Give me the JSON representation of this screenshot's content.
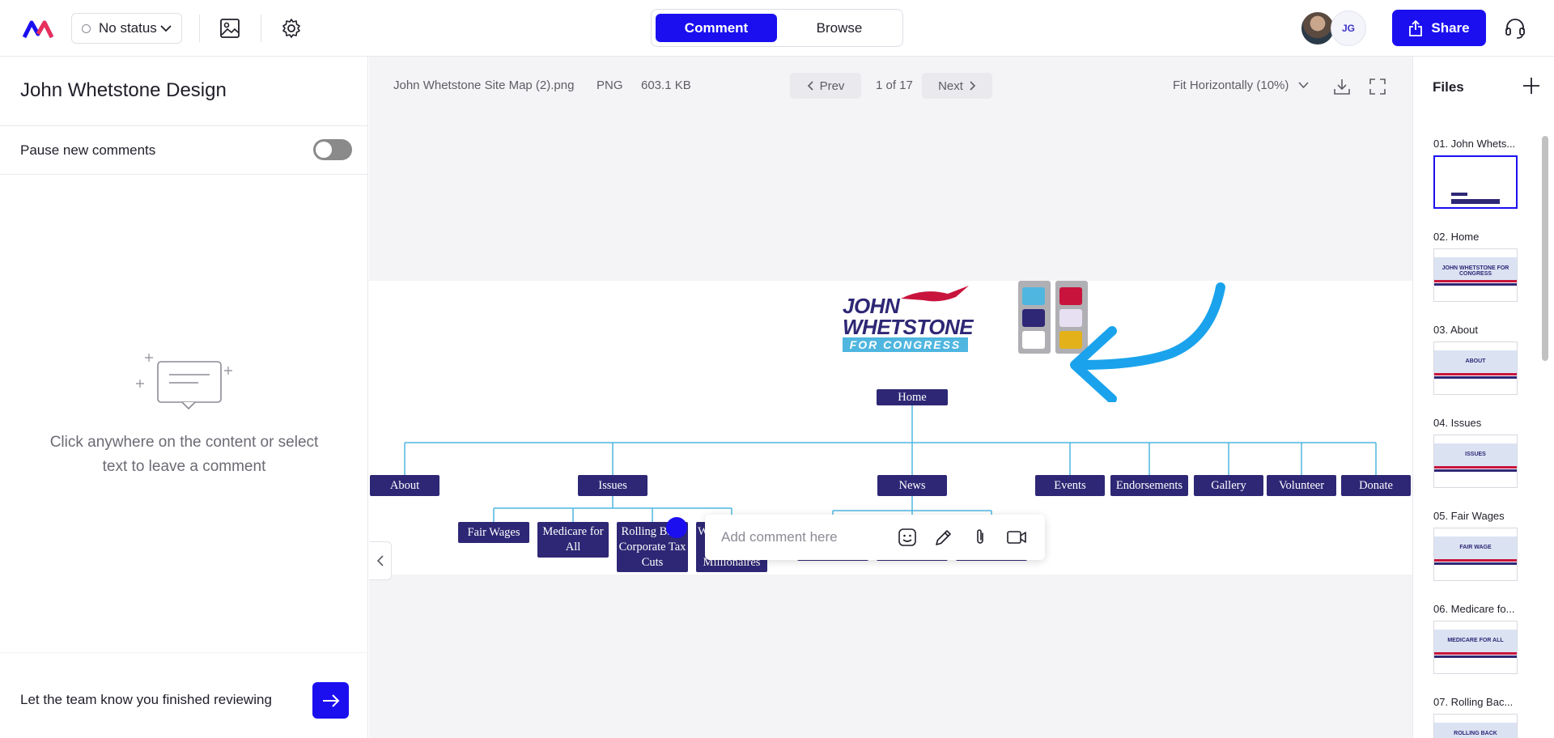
{
  "header": {
    "status_label": "No status",
    "tabs": [
      {
        "label": "Comment"
      },
      {
        "label": "Browse"
      }
    ],
    "avatar_initials": "JG",
    "share_label": "Share",
    "accent": "#1b0ff0"
  },
  "left_panel": {
    "project_title": "John Whetstone Design",
    "pause_label": "Pause new comments",
    "pause_enabled": false,
    "empty_text": "Click anywhere on the content or select text to leave a comment",
    "review_text": "Let the team know you finished reviewing"
  },
  "viewer": {
    "file_name": "John Whetstone Site Map (2).png",
    "file_type": "PNG",
    "file_size": "603.1 KB",
    "prev_label": "Prev",
    "page_indicator": "1 of 17",
    "next_label": "Next",
    "zoom_label": "Fit Horizontally (10%)",
    "comment_placeholder": "Add comment here"
  },
  "sitemap": {
    "logo_line1": "JOHN",
    "logo_line2": "WHETSTONE",
    "logo_line3": "FOR CONGRESS",
    "swatches": [
      "#4fb6e0",
      "#c8143c",
      "#2e2775",
      "#e6e0f2",
      "#ffffff",
      "#e3b11a"
    ],
    "home": "Home",
    "top_nodes": [
      "About",
      "Issues",
      "News",
      "Events",
      "Endorsements",
      "Gallery",
      "Volunteer",
      "Donate"
    ],
    "issues_children": [
      "Fair Wages",
      "Medicare for All",
      "Rolling Back Corporate Tax Cuts",
      "Wealth Tax on Ultra-Millionaires"
    ],
    "news_children": [
      "Press Releases",
      "Media Coverage",
      "Campaign Updates/Blog"
    ]
  },
  "files": {
    "title": "Files",
    "items": [
      {
        "label": "01. John Whets...",
        "thumb_title": ""
      },
      {
        "label": "02. Home",
        "thumb_title": "JOHN WHETSTONE FOR CONGRESS"
      },
      {
        "label": "03. About",
        "thumb_title": "ABOUT"
      },
      {
        "label": "04. Issues",
        "thumb_title": "ISSUES"
      },
      {
        "label": "05. Fair Wages",
        "thumb_title": "FAIR WAGE"
      },
      {
        "label": "06. Medicare fo...",
        "thumb_title": "MEDICARE FOR ALL"
      },
      {
        "label": "07. Rolling Bac...",
        "thumb_title": "ROLLING BACK"
      }
    ]
  }
}
